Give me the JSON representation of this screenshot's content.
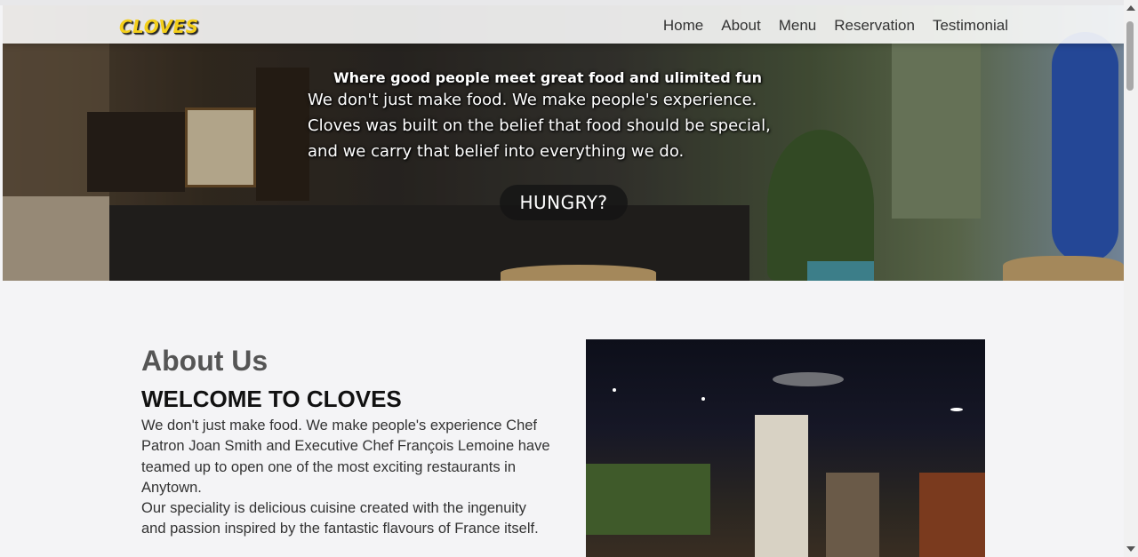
{
  "navbar": {
    "logo": "CLOVES",
    "links": [
      "Home",
      "About",
      "Menu",
      "Reservation",
      "Testimonial"
    ]
  },
  "hero": {
    "tagline": "Where good people meet great food and ulimited fun",
    "lines": [
      "We don't just make food. We make people's experience.",
      "Cloves was built on the belief that food should be special,",
      "and we carry that belief into everything we do."
    ],
    "button_label": "HUNGRY?"
  },
  "about": {
    "heading": "About Us",
    "subheading": "WELCOME TO CLOVES",
    "paragraphs": [
      "We don't just make food. We make people's experience Chef Patron Joan Smith and Executive Chef François Lemoine have teamed up to open one of the most exciting restaurants in Anytown.",
      "Our speciality is delicious cuisine created with the ingenuity and passion inspired by the fantastic flavours of France itself."
    ]
  },
  "colors": {
    "logo": "#f4cf1a",
    "background": "#f4f4f6"
  }
}
